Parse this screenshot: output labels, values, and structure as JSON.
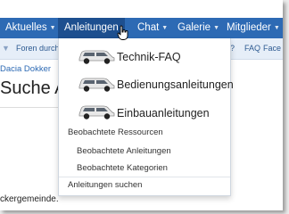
{
  "nav": {
    "tabs": [
      {
        "label": "Aktuelles"
      },
      {
        "label": "Anleitungen"
      },
      {
        "label": "Chat"
      },
      {
        "label": "Galerie"
      },
      {
        "label": "Mitglieder"
      }
    ]
  },
  "subnav": {
    "items": [
      "Foren durchsuchen",
      "r?",
      "FAQ",
      "Face"
    ]
  },
  "page": {
    "breadcrumb": "Dacia Dokker",
    "title": "Suche Anl",
    "footer_text": "ckergemeinde."
  },
  "dropdown": {
    "items": [
      {
        "label": "Technik-FAQ",
        "icon": "car-icon"
      },
      {
        "label": "Bedienungsanleitungen",
        "icon": "car-icon"
      },
      {
        "label": "Einbauanleitungen",
        "icon": "car-icon"
      }
    ],
    "section_title": "Beobachtete Ressourcen",
    "sub_items": [
      "Beobachtete Anleitungen",
      "Beobachtete Kategorien"
    ],
    "search_label": "Anleitungen suchen"
  },
  "colors": {
    "nav_bg": "#2d6ab4",
    "nav_active_bg": "#1d4f8f",
    "subnav_bg": "#e6eef8"
  }
}
